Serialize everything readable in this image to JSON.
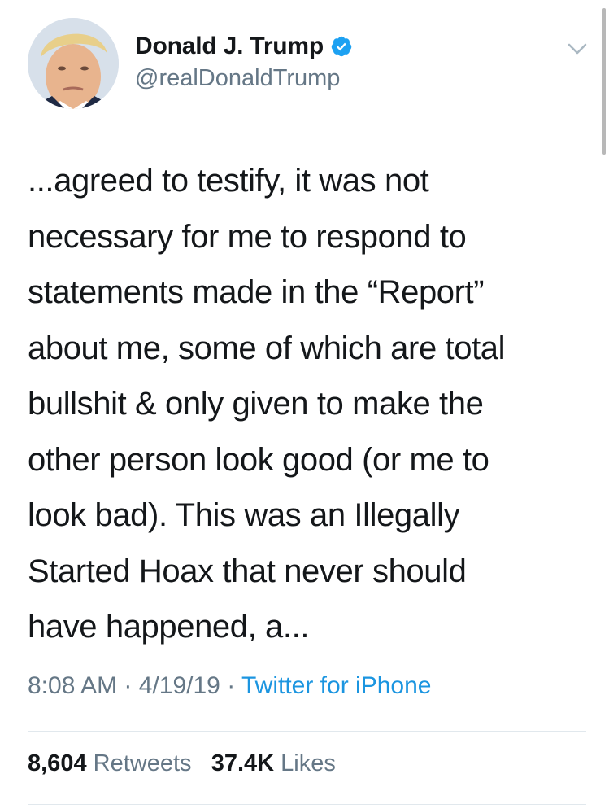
{
  "user": {
    "display_name": "Donald J. Trump",
    "handle": "@realDonaldTrump",
    "verified": true,
    "icons": [
      "avatar",
      "verified-badge-icon",
      "chevron-down-icon"
    ]
  },
  "tweet": {
    "lines": [
      "...agreed to testify, it was not",
      "necessary for me to respond to",
      "statements made in the “Report”",
      "about me, some of which are total",
      "bullshit & only given to make the",
      "other person look good (or me to",
      "look bad). This was an Illegally",
      "Started Hoax that never should",
      "have happened, a..."
    ],
    "time": "8:08 AM",
    "separator": "·",
    "date": "4/19/19",
    "source": "Twitter for iPhone"
  },
  "stats": {
    "retweets_count": "8,604",
    "retweets_label": "Retweets",
    "likes_count": "37.4K",
    "likes_label": "Likes"
  },
  "colors": {
    "text": "#14171a",
    "secondary": "#657786",
    "link": "#1b95e0",
    "verified": "#1da1f2",
    "divider": "#e1e8ed"
  }
}
